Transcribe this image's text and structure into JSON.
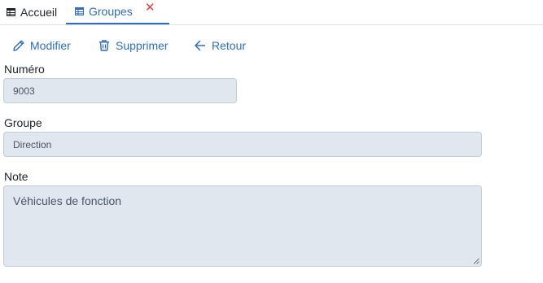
{
  "tabs": [
    {
      "label": "Accueil",
      "icon": "table-icon"
    },
    {
      "label": "Groupes",
      "icon": "table-icon",
      "close": "✕"
    }
  ],
  "toolbar": {
    "edit_label": "Modifier",
    "delete_label": "Supprimer",
    "back_label": "Retour"
  },
  "form": {
    "numero_label": "Numéro",
    "numero_value": "9003",
    "groupe_label": "Groupe",
    "groupe_value": "Direction",
    "note_label": "Note",
    "note_value": "Véhicules de fonction"
  },
  "colors": {
    "accent": "#2c6cc4",
    "close": "#e03e3e",
    "field_bg": "#e1e7ef"
  }
}
